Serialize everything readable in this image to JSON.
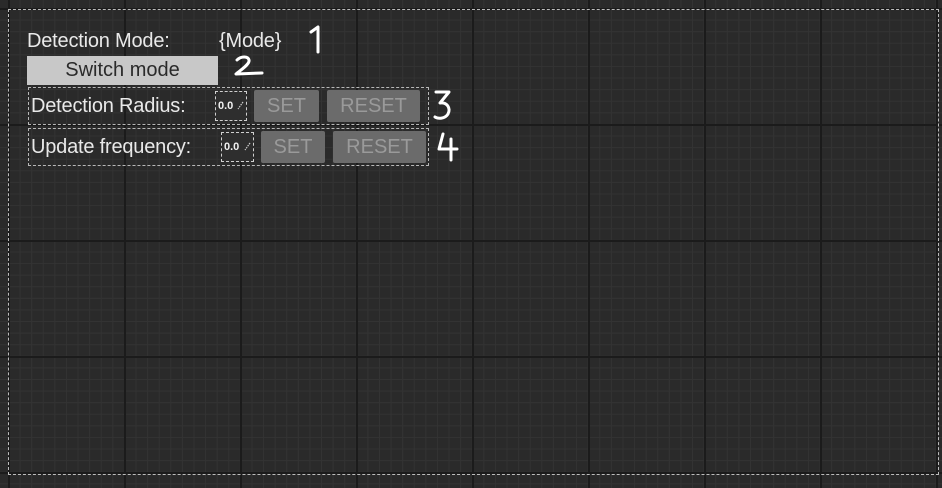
{
  "detection_mode": {
    "label": "Detection Mode:",
    "value": "{Mode}"
  },
  "switch_mode_button": "Switch mode",
  "rows": [
    {
      "label": "Detection Radius:",
      "value": "0.0",
      "set_label": "SET",
      "reset_label": "RESET"
    },
    {
      "label": "Update frequency:",
      "value": "0.0",
      "set_label": "SET",
      "reset_label": "RESET"
    }
  ],
  "annotations": [
    "1",
    "2",
    "3",
    "4"
  ]
}
